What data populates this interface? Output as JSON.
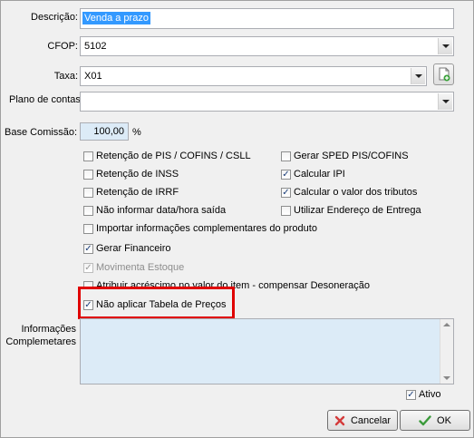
{
  "form": {
    "descricao_label": "Descrição:",
    "descricao_value": "Venda a prazo",
    "cfop_label": "CFOP:",
    "cfop_value": "5102",
    "taxa_label": "Taxa:",
    "taxa_value": "X01",
    "plano_label": "Plano de contas",
    "plano_value": "",
    "base_label": "Base Comissão:",
    "base_value": "100,00",
    "base_unit": "%",
    "info_label": "Informações\nComplemetares",
    "info_value": ""
  },
  "checkboxes": {
    "pis_cofins_csll": {
      "label": "Retenção de PIS / COFINS / CSLL",
      "checked": false
    },
    "sped": {
      "label": "Gerar SPED PIS/COFINS",
      "checked": false
    },
    "inss": {
      "label": "Retenção de INSS",
      "checked": false
    },
    "ipi": {
      "label": "Calcular IPI",
      "checked": true
    },
    "irrf": {
      "label": "Retenção de IRRF",
      "checked": false
    },
    "tributos": {
      "label": "Calcular o valor dos tributos",
      "checked": true
    },
    "data_hora": {
      "label": "Não informar data/hora saída",
      "checked": false
    },
    "endereco_entrega": {
      "label": "Utilizar Endereço de Entrega",
      "checked": false
    },
    "info_produto": {
      "label": "Importar informações complementares do produto",
      "checked": false
    },
    "financeiro": {
      "label": "Gerar Financeiro",
      "checked": true
    },
    "estoque": {
      "label": "Movimenta Estoque",
      "checked": true,
      "disabled": true
    },
    "acrescimo": {
      "label": "Atribuir acréscimo no valor do item - compensar Desoneração",
      "checked": false
    },
    "tabela_precos": {
      "label": "Não aplicar Tabela de Preços",
      "checked": true
    },
    "ativo": {
      "label": "Ativo",
      "checked": true
    }
  },
  "buttons": {
    "cancel_label": "Cancelar",
    "ok_label": "OK"
  },
  "colors": {
    "selection": "#3399ff",
    "highlight_border": "#e00000",
    "textarea_bg": "#dcebf7",
    "base_bg": "#dcebf7"
  }
}
